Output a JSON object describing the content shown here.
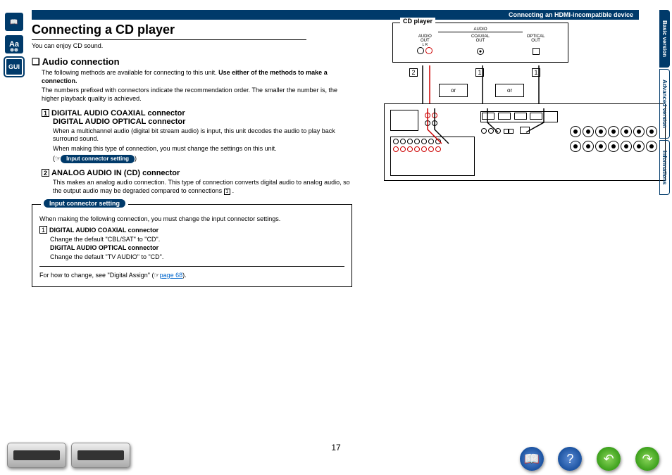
{
  "breadcrumb": "Connecting an HDMI-incompatible device",
  "title": "Connecting a CD player",
  "intro": "You can enjoy CD sound.",
  "section": {
    "bullet": "❏",
    "heading": "Audio connection",
    "p1a": "The following methods are available for connecting to this unit. ",
    "p1b": "Use either of the methods to make a connection.",
    "p2": "The numbers prefixed with connectors indicate the recommendation order. The smaller the number is, the higher playback quality is achieved."
  },
  "conn1": {
    "num": "1",
    "head_a": "DIGITAL AUDIO COAXIAL connector",
    "head_b": "DIGITAL AUDIO OPTICAL connector",
    "desc": "When a multichannel audio (digital bit stream audio) is input, this unit decodes the audio to play back surround sound.",
    "note": "When making this type of connection, you must change the settings on this unit.",
    "hand": "(☞",
    "badge": "Input connector setting",
    "hand_close": ")"
  },
  "conn2": {
    "num": "2",
    "head": "ANALOG AUDIO IN (CD) connector",
    "desc_a": "This makes an analog audio connection. This type of connection converts digital audio to analog audio, so the output audio may be degraded compared to connections ",
    "desc_b": "1",
    "desc_c": "."
  },
  "settings": {
    "title": "Input connector setting",
    "intro": "When making the following connection, you must change the input connector settings.",
    "num": "1",
    "line1": "DIGITAL AUDIO COAXIAL connector",
    "line1_desc": "Change the default \"CBL/SAT\" to \"CD\".",
    "line2": "DIGITAL AUDIO OPTICAL connector",
    "line2_desc": "Change the default \"TV AUDIO\" to \"CD\".",
    "footer_a": "For how to change, see \"Digital Assign\" (☞",
    "footer_link": "page 68",
    "footer_b": ")."
  },
  "diagram": {
    "cd_label": "CD player",
    "audio_head": "AUDIO",
    "audio_out": "AUDIO\nOUT",
    "lr": "L    R",
    "coax": "COAXIAL\nOUT",
    "optical": "OPTICAL\nOUT",
    "or": "or",
    "m1": "1",
    "m2": "2"
  },
  "tabs": {
    "basic": "Basic version",
    "advanced": "Advanced version",
    "info": "Informations"
  },
  "bottom": {
    "page": "17",
    "book": "📖",
    "help": "?",
    "back": "↶",
    "fwd": "↷"
  },
  "left_icons": {
    "book": "📖",
    "aa": "Aa",
    "gui": "GUI"
  }
}
